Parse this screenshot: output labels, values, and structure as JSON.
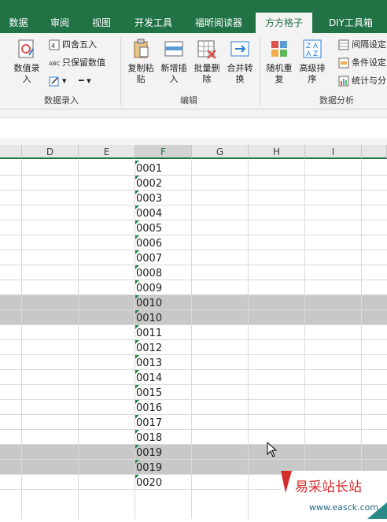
{
  "tabs": [
    "数据",
    "审阅",
    "视图",
    "开发工具",
    "福昕阅读器",
    "方方格子",
    "DIY工具箱"
  ],
  "active_tab": "方方格子",
  "ribbon": {
    "group_data_entry": {
      "label": "数据录入",
      "numeric_entry": "数值录\n入",
      "round": "四舍五入",
      "keep_value": "只保留数值"
    },
    "group_edit": {
      "label": "编辑",
      "copy_paste": "复制粘\n贴",
      "insert_new": "新增插\n入",
      "batch_delete": "批量删\n除",
      "merge_convert": "合并转\n换"
    },
    "group_analysis": {
      "label": "数据分析",
      "random_repeat": "随机重\n复",
      "advanced_sort": "高级排\n序",
      "interval": "间隔设定",
      "condition": "条件设定",
      "stats": "统计与分"
    }
  },
  "columns": [
    "D",
    "E",
    "F",
    "G",
    "H",
    "I"
  ],
  "rows": [
    "0001",
    "0002",
    "0003",
    "0004",
    "0005",
    "0006",
    "0007",
    "0008",
    "0009",
    "0010",
    "0010",
    "0011",
    "0012",
    "0013",
    "0014",
    "0015",
    "0016",
    "0017",
    "0018",
    "0019",
    "0019",
    "0020"
  ],
  "highlighted_rows": [
    9,
    10,
    19,
    20
  ],
  "watermark": {
    "line1": "易采站长站",
    "line2": "www.easck.com"
  },
  "colors": {
    "accent": "#217346",
    "highlight": "#c8c8c8",
    "watermark_red": "#d42b2b"
  }
}
